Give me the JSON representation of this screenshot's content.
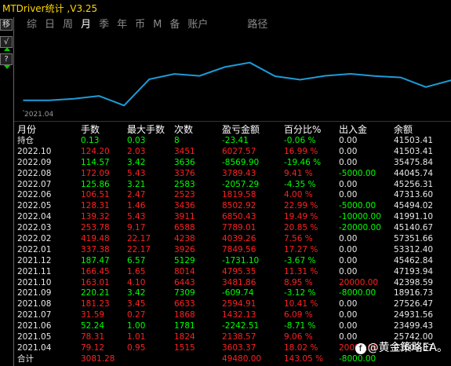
{
  "window": {
    "title": "MTDriver统计 ,V3.25"
  },
  "toolbar_left": {
    "b1": "移",
    "b2": "√",
    "b3": "?"
  },
  "tabs": [
    "综",
    "日",
    "周",
    "月",
    "季",
    "年",
    "币",
    "M",
    "备",
    "账户",
    "",
    "路径"
  ],
  "active_tab": "月",
  "chart_data": {
    "type": "line",
    "x_tick": "2021.04",
    "series": [
      {
        "values": [
          23603.37,
          23499.43,
          24931.56,
          27526.47,
          18916.73,
          42398.59,
          47193.94,
          45462.84,
          53312.4,
          57351.66,
          45140.67,
          41991.1,
          45494.02,
          47313.6,
          45256.31,
          44045.74,
          35475.84,
          41503.41
        ]
      }
    ],
    "color": "#1e9bd7"
  },
  "table": {
    "headers": [
      "月份",
      "手数",
      "最大手数",
      "次数",
      "盈亏金额",
      "百分比%",
      "出入金",
      "余额"
    ],
    "rows": [
      [
        "持仓",
        "0.13",
        "0.03",
        "8",
        "-23.41",
        "-0.06 %",
        "0.00",
        "41503.41"
      ],
      [
        "2022.10",
        "124.20",
        "2.03",
        "3451",
        "6027.57",
        "16.99 %",
        "0.00",
        "41503.41"
      ],
      [
        "2022.09",
        "114.57",
        "3.42",
        "3636",
        "-8569.90",
        "-19.46 %",
        "0.00",
        "35475.84"
      ],
      [
        "2022.08",
        "172.09",
        "5.43",
        "3376",
        "3789.43",
        "9.41 %",
        "-5000.00",
        "44045.74"
      ],
      [
        "2022.07",
        "125.86",
        "3.21",
        "2583",
        "-2057.29",
        "-4.35 %",
        "0.00",
        "45256.31"
      ],
      [
        "2022.06",
        "106.51",
        "2.47",
        "2523",
        "1819.58",
        "4.00 %",
        "0.00",
        "47313.60"
      ],
      [
        "2022.05",
        "128.31",
        "1.46",
        "3436",
        "8502.92",
        "22.99 %",
        "-5000.00",
        "45494.02"
      ],
      [
        "2022.04",
        "139.32",
        "5.43",
        "3911",
        "6850.43",
        "19.49 %",
        "-10000.00",
        "41991.10"
      ],
      [
        "2022.03",
        "253.78",
        "9.17",
        "6588",
        "7789.01",
        "20.85 %",
        "-20000.00",
        "45140.67"
      ],
      [
        "2022.02",
        "419.48",
        "22.17",
        "4238",
        "4039.26",
        "7.56 %",
        "0.00",
        "57351.66"
      ],
      [
        "2022.01",
        "337.38",
        "22.17",
        "3926",
        "7849.56",
        "17.27 %",
        "0.00",
        "53312.40"
      ],
      [
        "2021.12",
        "187.47",
        "6.57",
        "5129",
        "-1731.10",
        "-3.67 %",
        "0.00",
        "45462.84"
      ],
      [
        "2021.11",
        "166.45",
        "1.65",
        "8014",
        "4795.35",
        "11.31 %",
        "0.00",
        "47193.94"
      ],
      [
        "2021.10",
        "163.01",
        "4.10",
        "6443",
        "3481.86",
        "8.95 %",
        "20000.00",
        "42398.59"
      ],
      [
        "2021.09",
        "220.21",
        "3.42",
        "7309",
        "-609.74",
        "-3.12 %",
        "-8000.00",
        "18916.73"
      ],
      [
        "2021.08",
        "181.23",
        "3.45",
        "6633",
        "2594.91",
        "10.41 %",
        "0.00",
        "27526.47"
      ],
      [
        "2021.07",
        "31.59",
        "0.27",
        "1868",
        "1432.13",
        "6.09 %",
        "0.00",
        "24931.56"
      ],
      [
        "2021.06",
        "52.24",
        "1.00",
        "1781",
        "-2242.51",
        "-8.71 %",
        "0.00",
        "23499.43"
      ],
      [
        "2021.05",
        "78.31",
        "1.01",
        "1824",
        "2138.57",
        "9.06 %",
        "0.00",
        "25742.00"
      ],
      [
        "2021.04",
        "79.12",
        "0.95",
        "1515",
        "3603.37",
        "18.02 %",
        "20000.00",
        "23603.37"
      ],
      [
        "合计",
        "3081.28",
        "",
        "",
        "49480.00",
        "143.05 %",
        "-8000.00",
        ""
      ]
    ]
  },
  "watermark": "@黄金策略EA。"
}
